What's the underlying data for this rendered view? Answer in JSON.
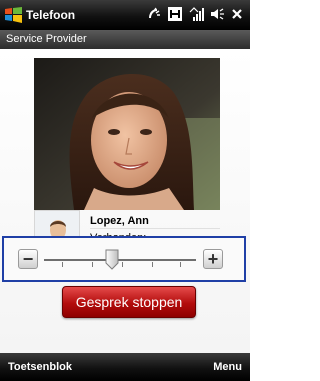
{
  "titlebar": {
    "title": "Telefoon",
    "logo_icon": "windows-flag-icon",
    "status_icons": [
      "phone-signal-icon",
      "h-network-icon",
      "signal-strength-icon",
      "speaker-icon",
      "close-icon"
    ]
  },
  "subbar": {
    "text": "Service Provider"
  },
  "caller": {
    "name": "Lopez, Ann",
    "status": "Verbonden:",
    "photo_icon": "caller-photo",
    "thumbnail_icon": "contact-silhouette-icon"
  },
  "volume": {
    "minus_label": "−",
    "plus_label": "+",
    "level": 0.45
  },
  "end_call": {
    "label": "Gesprek stoppen"
  },
  "softkeys": {
    "left": "Toetsenblok",
    "right": "Menu"
  },
  "colors": {
    "titlebar": "#111111",
    "highlight_frame": "#1f3fa6",
    "end_call": "#c41414"
  }
}
